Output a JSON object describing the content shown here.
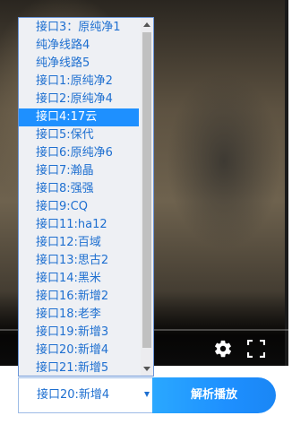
{
  "player": {
    "settings_icon": "gear-icon",
    "fullscreen_icon": "fullscreen-icon"
  },
  "line_dropdown": {
    "options": [
      "接口3：原纯净1",
      "纯净线路4",
      "纯净线路5",
      "接口1:原纯净2",
      "接口2:原纯净4",
      "接口4:17云",
      "接口5:保代",
      "接口6:原纯净6",
      "接口7:瀚晶",
      "接口8:强强",
      "接口9:CQ",
      "接口11:ha12",
      "接口12:百域",
      "接口13:思古2",
      "接口14:黑米",
      "接口16:新增2",
      "接口18:老李",
      "接口19:新增3",
      "接口20:新增4",
      "接口21:新增5"
    ],
    "highlighted_index": 5,
    "selected_value": "接口20:新增4"
  },
  "actions": {
    "parse_play_label": "解析播放"
  },
  "colors": {
    "accent": "#1e90ff",
    "option_text": "#1e6fd0",
    "dropdown_bg": "#eef0f4"
  }
}
